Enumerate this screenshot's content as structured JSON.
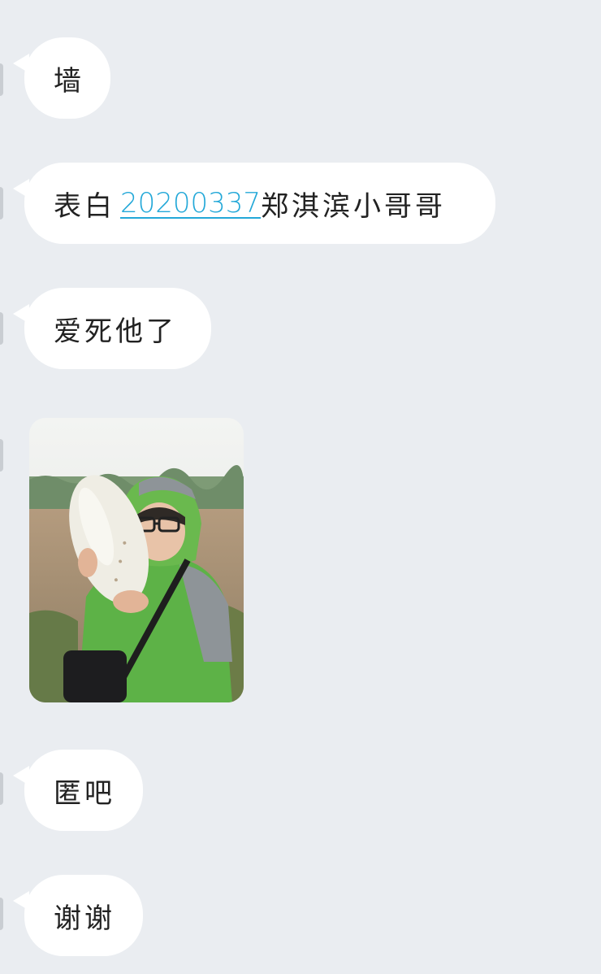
{
  "messages": [
    {
      "text": "墙"
    },
    {
      "prefix": "表白",
      "link": "20200337",
      "suffix": "郑淇滨小哥哥"
    },
    {
      "text": "爱死他了"
    },
    {
      "image_desc_icon": "photo-thumbnail"
    },
    {
      "text": "匿吧"
    },
    {
      "text": "谢谢"
    }
  ],
  "colors": {
    "background": "#EAEDF1",
    "bubble": "#FFFFFF",
    "link": "#23A8D8"
  }
}
